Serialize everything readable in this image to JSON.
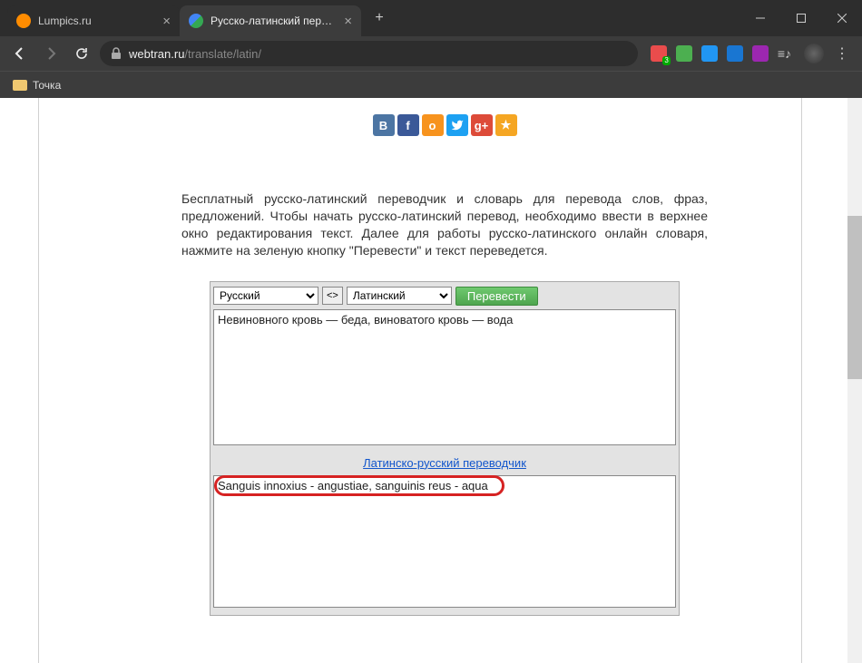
{
  "browser": {
    "tabs": [
      {
        "title": "Lumpics.ru",
        "active": false
      },
      {
        "title": "Русско-латинский переводчик о",
        "active": true
      }
    ],
    "url_host": "webtran.ru",
    "url_path": "/translate/latin/",
    "bookmark": "Точка",
    "ext_badge": "3"
  },
  "social": {
    "vk": "B",
    "fb": "f",
    "ok": "o",
    "tw": "t",
    "gp": "g+",
    "bk": "★"
  },
  "description": "Бесплатный русско-латинский переводчик и словарь для перевода слов, фраз, предложений. Чтобы начать русско-латинский перевод, необходимо ввести в верхнее окно редактирования текст. Далее для работы русско-латинского онлайн словаря, нажмите на зеленую кнопку \"Перевести\" и текст переведется.",
  "translator": {
    "lang_from": "Русский",
    "lang_to": "Латинский",
    "swap": "<>",
    "button": "Перевести",
    "input": "Невиновного кровь — беда, виноватого кровь — вода",
    "reverse_link": "Латинско-русский переводчик",
    "output": "Sanguis innoxius - angustiae, sanguinis reus - aqua"
  }
}
